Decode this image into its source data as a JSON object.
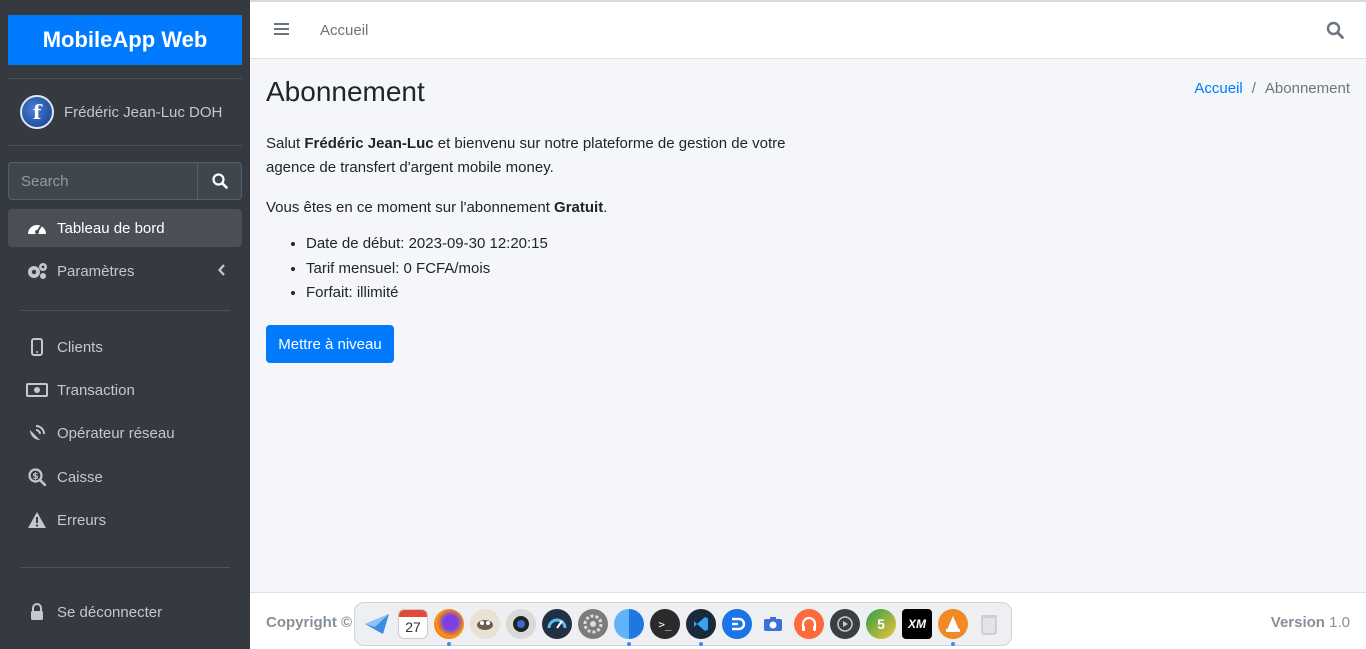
{
  "sidebar": {
    "brand": "MobileApp Web",
    "user_name": "Frédéric Jean-Luc DOH",
    "avatar_letter": "f",
    "search_placeholder": "Search",
    "nav": {
      "dashboard": "Tableau de bord",
      "settings": "Paramètres",
      "clients": "Clients",
      "transaction": "Transaction",
      "operator": "Opérateur réseau",
      "cashbox": "Caisse",
      "errors": "Erreurs",
      "logout": "Se déconnecter"
    }
  },
  "topbar": {
    "home": "Accueil"
  },
  "page": {
    "title": "Abonnement",
    "breadcrumb": {
      "home": "Accueil",
      "current": "Abonnement"
    },
    "greeting_prefix": "Salut ",
    "greeting_name": "Frédéric Jean-Luc",
    "greeting_suffix": " et bienvenu sur notre plateforme de gestion de votre agence de transfert d'argent mobile money.",
    "plan_prefix": "Vous êtes en ce moment sur l'abonnement ",
    "plan_name": "Gratuit",
    "plan_suffix": ".",
    "details": [
      "Date de début: 2023-09-30 12:20:15",
      "Tarif mensuel: 0 FCFA/mois",
      "Forfait: illimité"
    ],
    "upgrade_label": "Mettre à niveau"
  },
  "footer": {
    "copyright": "Copyright ©",
    "version_label": "Version",
    "version_value": "1.0"
  },
  "dock": {
    "calendar_day": "27",
    "apps": [
      "mail-icon",
      "calendar-icon",
      "firefox-icon",
      "gimp-icon",
      "camera-lens-icon",
      "speedometer-icon",
      "settings-icon",
      "finder-icon",
      "terminal-icon",
      "vscode-icon",
      "discord-icon",
      "screenshot-icon",
      "headphones-icon",
      "media-player-icon",
      "metatrader-icon",
      "xm-icon",
      "vlc-icon",
      "trash-icon"
    ]
  },
  "colors": {
    "primary": "#007bff",
    "sidebar": "#343a40",
    "background": "#f4f6f9"
  }
}
